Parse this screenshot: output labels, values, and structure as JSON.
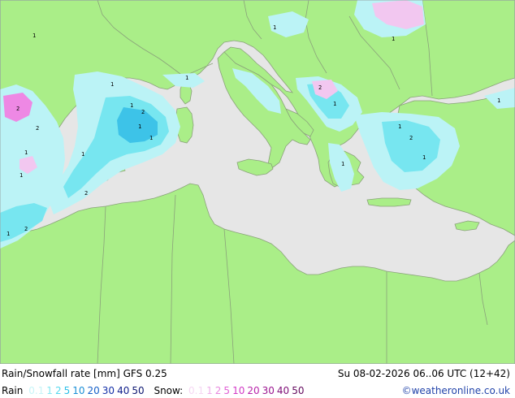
{
  "map": {
    "colors": {
      "sea": "#e6e6e6",
      "land": "#aaee88",
      "border": "#8aa27a",
      "rain_light": "#bbf3f6",
      "rain_medium": "#77e6f0",
      "rain_heavy": "#3dc3e8",
      "snow_light": "#f2c7f0",
      "snow_medium": "#ee88e4"
    }
  },
  "footer": {
    "title": "Rain/Snowfall rate [mm] GFS 0.25",
    "datetime": "Su 08-02-2026 06..06 UTC (12+42)",
    "rain_label": "Rain",
    "rain_levels": [
      {
        "text": "0.1",
        "color": "#c8f5f8"
      },
      {
        "text": "1",
        "color": "#86e8f2"
      },
      {
        "text": "2",
        "color": "#55d8ee"
      },
      {
        "text": "5",
        "color": "#2bbfe8"
      },
      {
        "text": "10",
        "color": "#1a8fd6"
      },
      {
        "text": "20",
        "color": "#1560c8"
      },
      {
        "text": "30",
        "color": "#1430a8"
      },
      {
        "text": "40",
        "color": "#12208c"
      },
      {
        "text": "50",
        "color": "#0c1670"
      }
    ],
    "snow_label": "Snow:",
    "snow_levels": [
      {
        "text": "0.1",
        "color": "#f6d8f3"
      },
      {
        "text": "1",
        "color": "#f0b0ea"
      },
      {
        "text": "2",
        "color": "#e888de"
      },
      {
        "text": "5",
        "color": "#e060d4"
      },
      {
        "text": "10",
        "color": "#d23ac6"
      },
      {
        "text": "20",
        "color": "#b824aa"
      },
      {
        "text": "30",
        "color": "#9c1690"
      },
      {
        "text": "40",
        "color": "#801078"
      },
      {
        "text": "50",
        "color": "#640a5e"
      }
    ],
    "credit": "©weatheronline.co.uk",
    "credit_color": "#2244aa"
  }
}
